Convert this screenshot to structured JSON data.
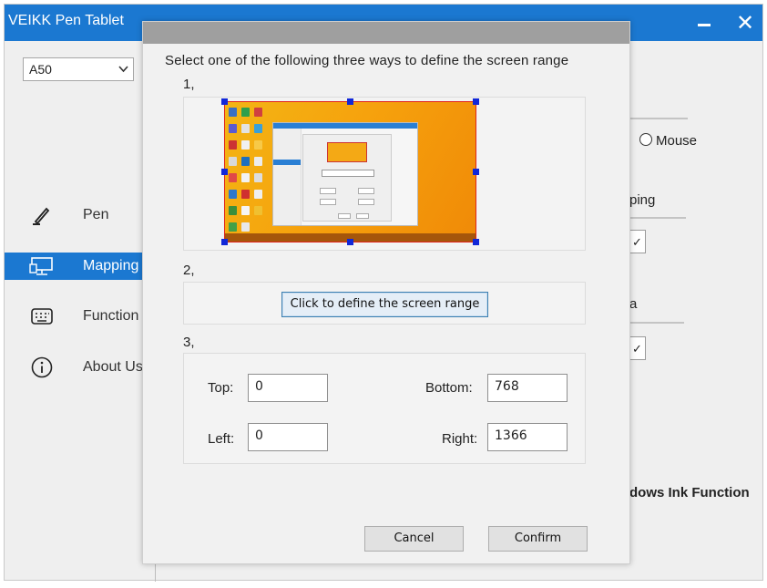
{
  "window": {
    "title": "VEIKK Pen Tablet",
    "close_glyph": "✕",
    "accent": "#1b78d1"
  },
  "device_select": {
    "value": "A50",
    "chevron": "⌄"
  },
  "sidebar": {
    "items": [
      {
        "label": "Pen",
        "icon": "pen-icon",
        "active": false
      },
      {
        "label": "Mapping",
        "icon": "monitor-icon",
        "active": true
      },
      {
        "label": "Function",
        "icon": "keyboard-icon",
        "active": false
      },
      {
        "label": "About Us",
        "icon": "info-icon",
        "active": false
      }
    ]
  },
  "background_panel": {
    "mouse_option": "Mouse",
    "ping_fragment": "ping",
    "a_fragment": "a",
    "ink_fragment": "dows Ink Function",
    "check_glyph": "✓"
  },
  "dialog": {
    "instruction": "Select one of the following three ways to define the screen range",
    "step1": "1,",
    "step2": "2,",
    "step3": "3,",
    "define_button": "Click to define the screen range",
    "fields": {
      "top_label": "Top:",
      "top_value": "0",
      "bottom_label": "Bottom:",
      "bottom_value": "768",
      "left_label": "Left:",
      "left_value": "0",
      "right_label": "Right:",
      "right_value": "1366"
    },
    "cancel_label": "Cancel",
    "confirm_label": "Confirm",
    "preview_border_color": "#e0241b",
    "handle_color": "#1127d8"
  }
}
